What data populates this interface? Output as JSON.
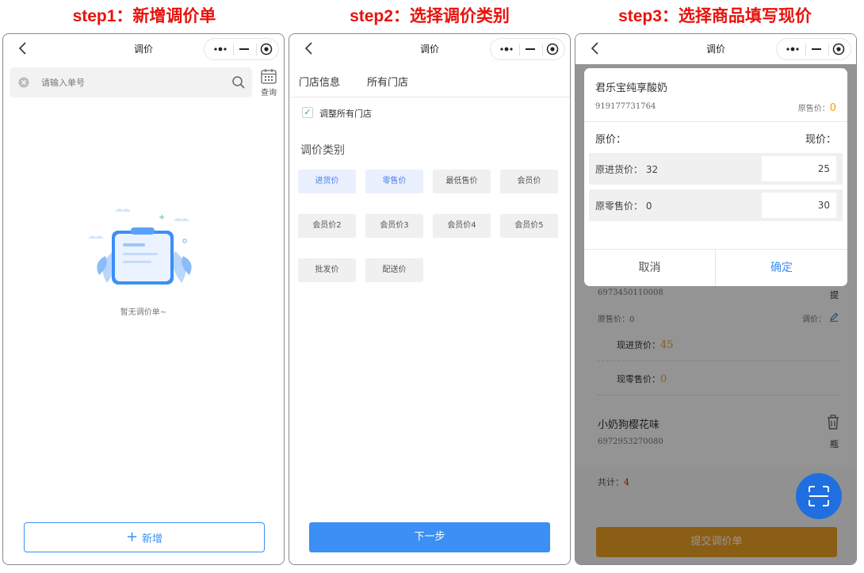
{
  "steps": {
    "step1": "step1：新增调价单",
    "step2": "step2：选择调价类别",
    "step3": "step3：选择商品填写现价"
  },
  "nav": {
    "title": "调价"
  },
  "screen1": {
    "search_placeholder": "请输入单号",
    "query_label": "查询",
    "empty_text": "暂无调价单~",
    "add_label": "新增"
  },
  "screen2": {
    "store_label": "门店信息",
    "store_value": "所有门店",
    "checkbox_label": "调整所有门店",
    "category_title": "调价类别",
    "categories": [
      "进货价",
      "零售价",
      "最低售价",
      "会员价",
      "会员价2",
      "会员价3",
      "会员价4",
      "会员价5",
      "批发价",
      "配送价"
    ],
    "next_label": "下一步"
  },
  "screen3": {
    "modal": {
      "product_name": "君乐宝纯享酸奶",
      "product_code": "919177731764",
      "orig_sale_label": "原售价：",
      "orig_sale_value": "0",
      "col_orig": "原价：",
      "col_now": "现价：",
      "row1_label": "原进货价：",
      "row1_orig": "32",
      "row1_now": "25",
      "row2_label": "原零售价：",
      "row2_orig": "0",
      "row2_now": "30",
      "cancel": "取消",
      "confirm": "确定"
    },
    "item1": {
      "code": "6973450110008",
      "unit": "提",
      "orig_sale_label": "原售价：",
      "orig_sale_value": "0",
      "adjust_label": "调价：",
      "now_purchase_label": "现进货价：",
      "now_purchase_value": "45",
      "now_retail_label": "现零售价：",
      "now_retail_value": "0"
    },
    "item2": {
      "name": "小奶狗樱花味",
      "code": "6972953270080",
      "unit": "瓶"
    },
    "total_label": "共计：",
    "total_value": "4",
    "submit_label": "提交调价单"
  },
  "colors": {
    "accent": "#3b8ff5",
    "step_red": "#e8120c",
    "orange": "#f0a326",
    "scan_blue": "#1f6fe0"
  }
}
